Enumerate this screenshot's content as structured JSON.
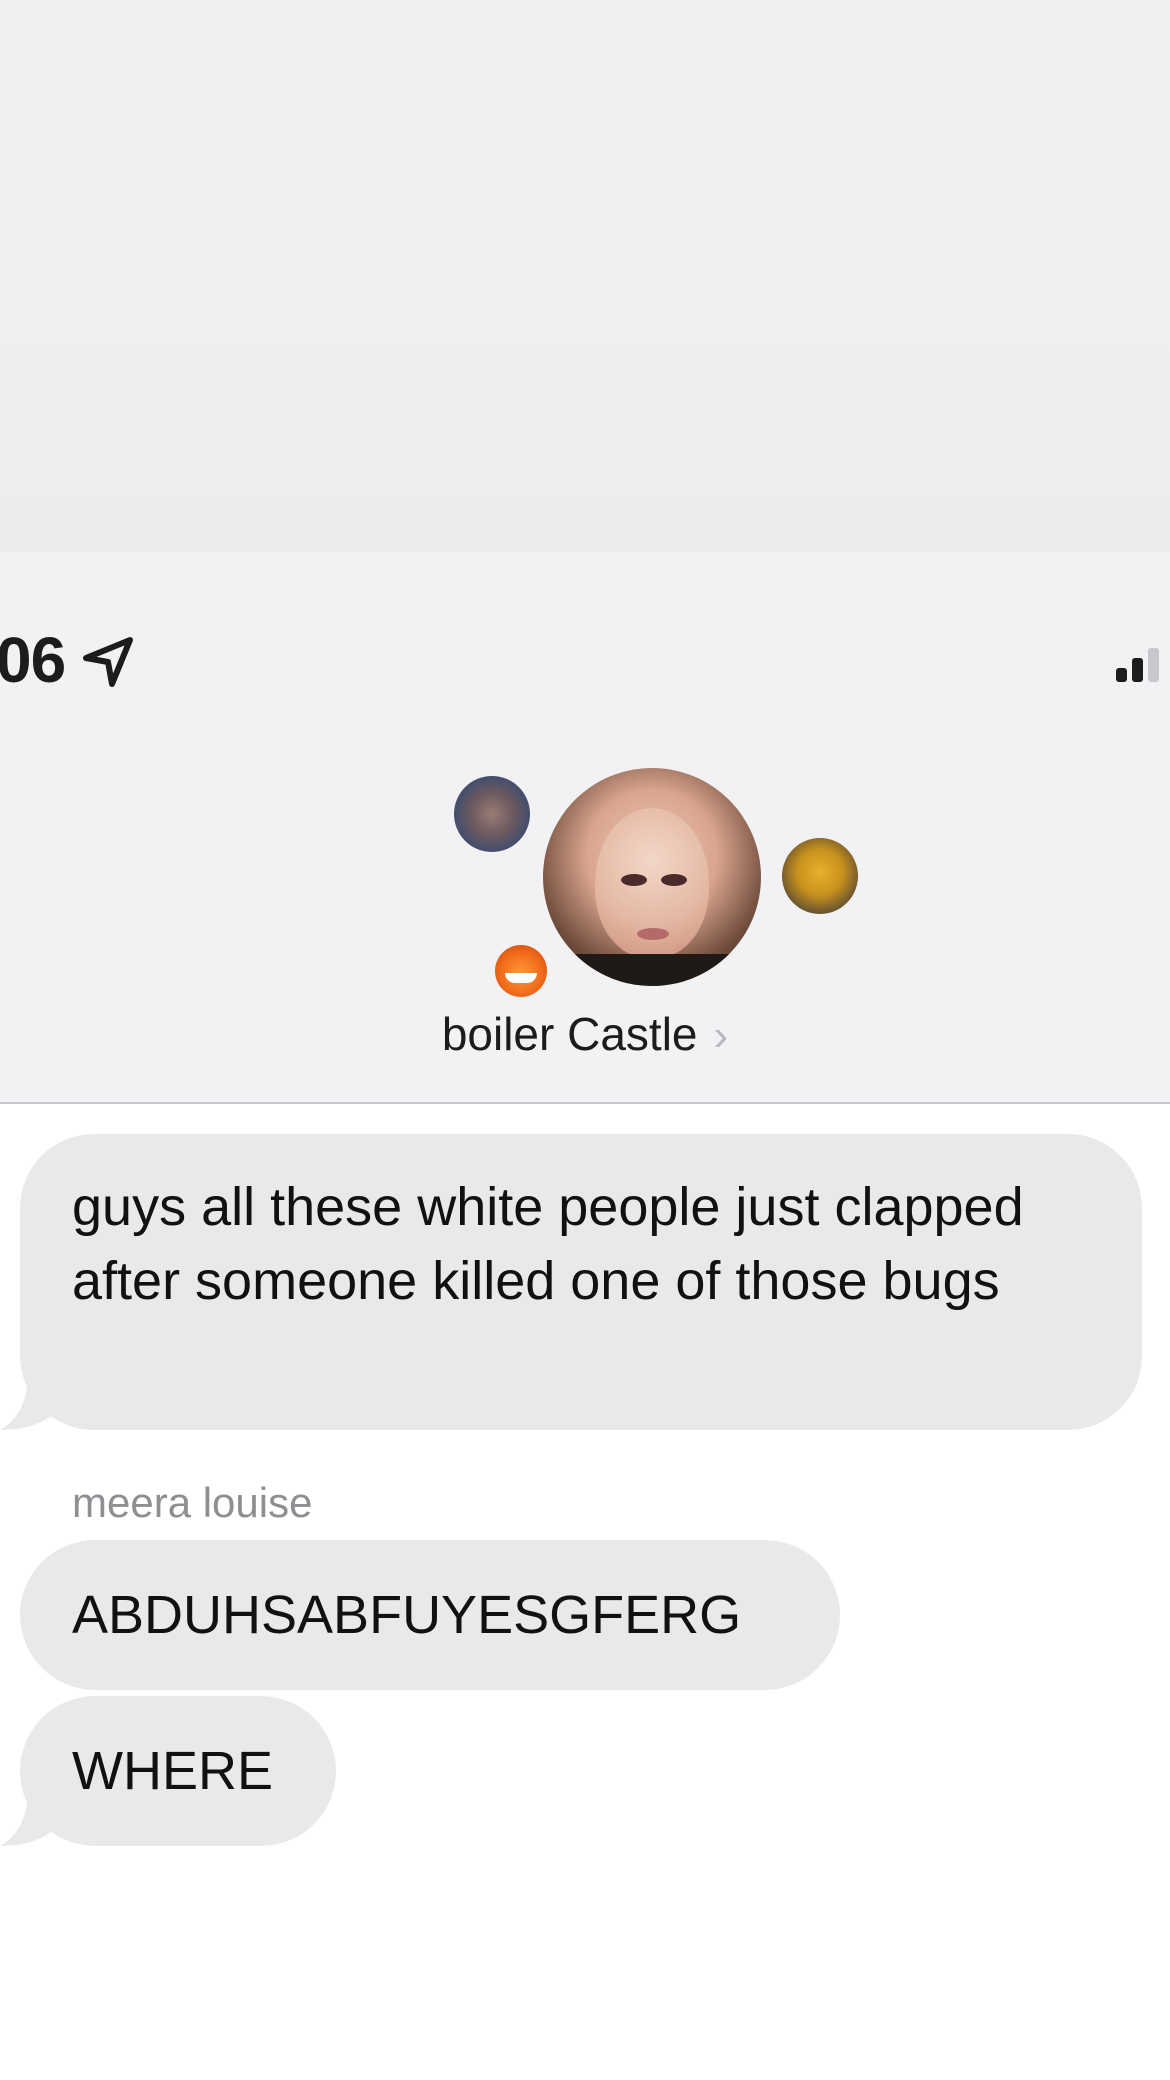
{
  "status_bar": {
    "time_partial": "06",
    "location_icon": "location-arrow-icon",
    "signal_icon": "cellular-signal-icon"
  },
  "conversation": {
    "group_name": "boiler Castle",
    "chevron": "›",
    "chevron_icon": "chevron-right-icon"
  },
  "messages": [
    {
      "sender": "",
      "text": "guys all these white people just clapped after someone killed one of those bugs"
    },
    {
      "sender": "meera louise",
      "text": "ABDUHSABFUYESGFERG"
    },
    {
      "sender": "",
      "text": "WHERE"
    }
  ],
  "colors": {
    "header_bg": "#f2f2f4",
    "incoming_bubble": "#e9e9eb",
    "sender_label": "#8e8e93",
    "divider": "#c8c8cc"
  }
}
